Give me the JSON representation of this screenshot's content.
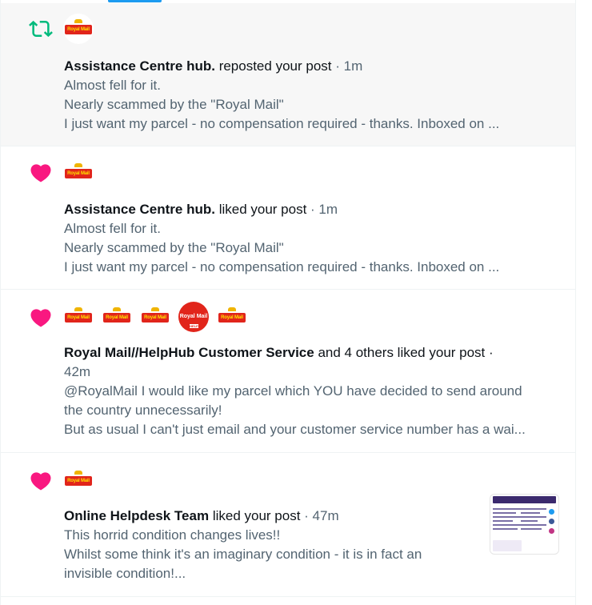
{
  "logo_text": "Royal Mail",
  "avatar_badge_text": "Royal Mail",
  "avatar_badge_sub": "HELP",
  "colors": {
    "repost": "#00ba7c",
    "like": "#f91880",
    "royal_red": "#e1251b",
    "accent": "#1d9bf0"
  },
  "notifications": [
    {
      "type": "repost",
      "icon": "repost-icon",
      "actor": "Assistance Centre hub.",
      "action": "reposted your post",
      "time": "· 1m",
      "lines": [
        "Almost fell for it.",
        "Nearly scammed by the \"Royal Mail\"",
        "I just want my parcel - no compensation required - thanks.  Inboxed on ..."
      ]
    },
    {
      "type": "like",
      "icon": "heart-icon",
      "actor": "Assistance Centre hub.",
      "action": "liked your post",
      "time": "· 1m",
      "lines": [
        "Almost fell for it.",
        "Nearly scammed by the \"Royal Mail\"",
        "I just want my parcel - no compensation required - thanks.  Inboxed on ..."
      ]
    },
    {
      "type": "like",
      "icon": "heart-icon",
      "actor": "Royal Mail//HelpHub Customer Service",
      "action": "and 4 others liked your post ·",
      "time": "42m",
      "lines": [
        "@RoyalMail I would like my parcel which YOU have decided to send around",
        "the country unnecessarily!",
        "But as usual I can't just email and your customer service number has a wai..."
      ]
    },
    {
      "type": "like",
      "icon": "heart-icon",
      "actor": "Online Helpdesk Team",
      "action": "liked your post",
      "time": "· 47m",
      "lines": [
        "This horrid condition changes lives!!",
        "Whilst some think it's an imaginary condition - it is in fact an",
        "invisible condition!..."
      ]
    }
  ]
}
